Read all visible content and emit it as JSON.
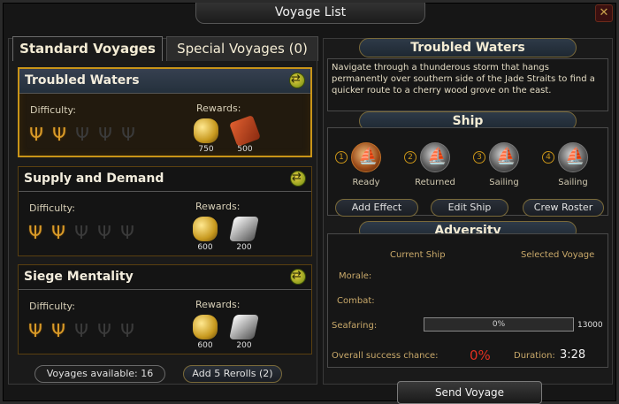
{
  "window": {
    "title": "Voyage List",
    "close_label": "✕"
  },
  "tabs": {
    "standard": "Standard Voyages",
    "special": "Special Voyages (0)"
  },
  "voyages": [
    {
      "name": "Troubled Waters",
      "difficulty_label": "Difficulty:",
      "rewards_label": "Rewards:",
      "difficulty_level": 2,
      "rewards": [
        {
          "icon": "gold-pile-icon",
          "amount": "750"
        },
        {
          "icon": "wood-logs-icon",
          "amount": "500"
        }
      ]
    },
    {
      "name": "Supply and Demand",
      "difficulty_label": "Difficulty:",
      "rewards_label": "Rewards:",
      "difficulty_level": 2,
      "rewards": [
        {
          "icon": "gold-pile-icon",
          "amount": "600"
        },
        {
          "icon": "silver-bar-icon",
          "amount": "200"
        }
      ]
    },
    {
      "name": "Siege Mentality",
      "difficulty_label": "Difficulty:",
      "rewards_label": "Rewards:",
      "difficulty_level": 2,
      "rewards": [
        {
          "icon": "gold-pile-icon",
          "amount": "600"
        },
        {
          "icon": "silver-bar-icon",
          "amount": "200"
        }
      ]
    }
  ],
  "footer": {
    "voyages_available": "Voyages available: 16",
    "rerolls_label": "Add 5 Rerolls (2)"
  },
  "detail": {
    "title": "Troubled Waters",
    "description": "Navigate through a thunderous storm that hangs permanently over southern side of the Jade Straits to find a quicker route to a cherry wood grove on the east."
  },
  "ship": {
    "title": "Ship",
    "slots": [
      {
        "num": "1",
        "status": "Ready"
      },
      {
        "num": "2",
        "status": "Returned"
      },
      {
        "num": "3",
        "status": "Sailing"
      },
      {
        "num": "4",
        "status": "Sailing"
      }
    ],
    "add_effect": "Add Effect",
    "edit_ship": "Edit Ship",
    "crew_roster": "Crew Roster"
  },
  "adversity": {
    "title": "Adversity",
    "current_ship": "Current Ship",
    "selected_voyage": "Selected Voyage",
    "morale": "Morale:",
    "combat": "Combat:",
    "seafaring": "Seafaring:",
    "seafaring_progress": "0%",
    "seafaring_target": "13000",
    "success_label": "Overall success chance:",
    "success_value": "0%",
    "duration_label": "Duration:",
    "duration_value": "3:28"
  },
  "send_label": "Send Voyage",
  "colors": {
    "accent_gold": "#c99418",
    "success_red": "#e03020"
  }
}
